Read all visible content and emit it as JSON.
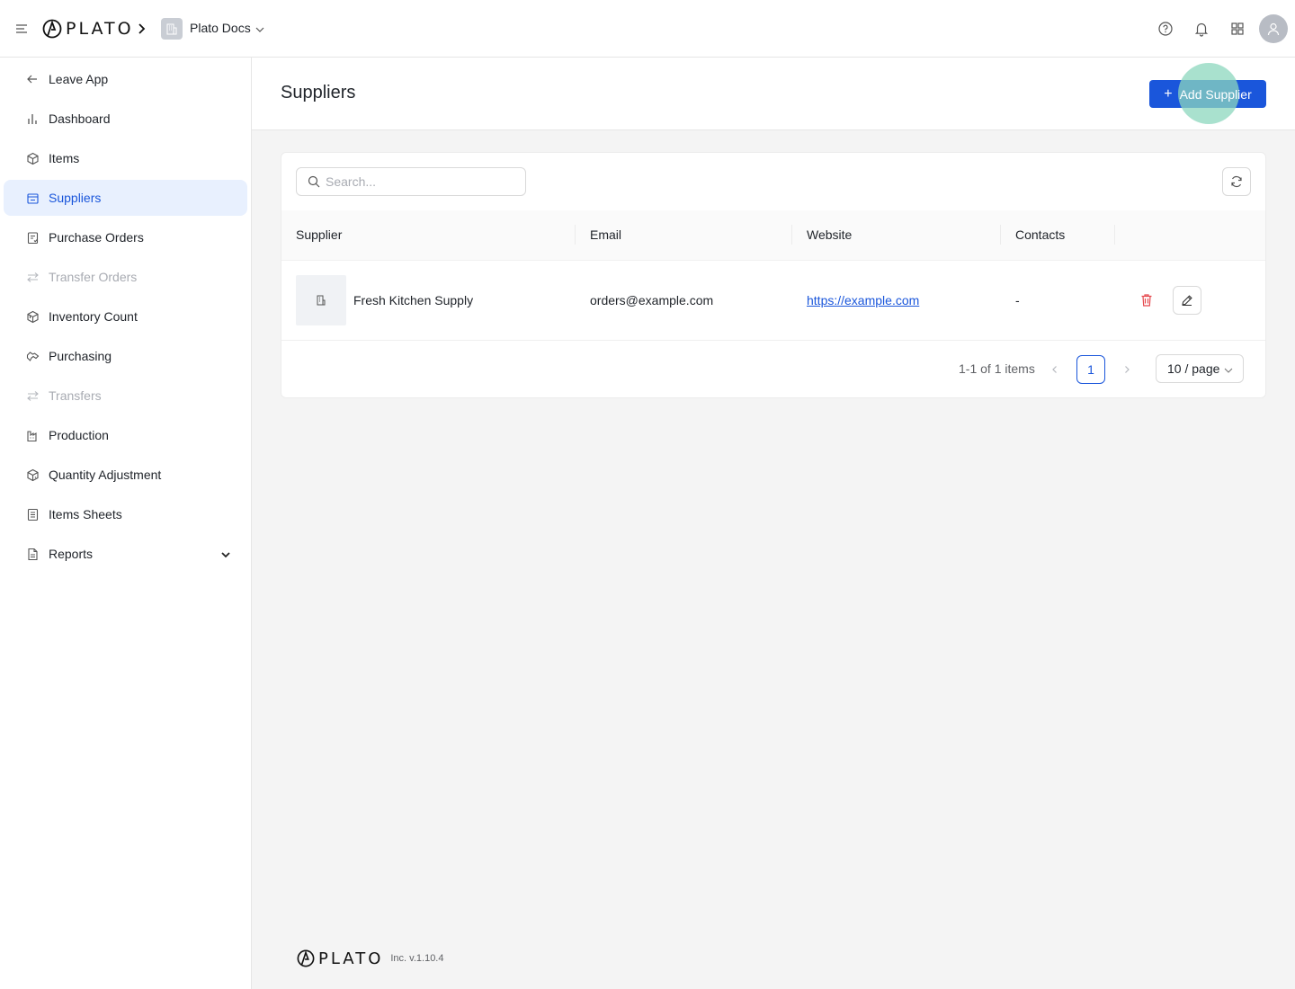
{
  "topbar": {
    "brand": "PLATO",
    "org_name": "Plato Docs"
  },
  "sidebar": {
    "items": [
      {
        "label": "Leave App",
        "icon": "arrow-left-icon",
        "state": "normal"
      },
      {
        "label": "Dashboard",
        "icon": "bar-chart-icon",
        "state": "normal"
      },
      {
        "label": "Items",
        "icon": "box-icon",
        "state": "normal"
      },
      {
        "label": "Suppliers",
        "icon": "store-icon",
        "state": "active"
      },
      {
        "label": "Purchase Orders",
        "icon": "clipboard-icon",
        "state": "normal"
      },
      {
        "label": "Transfer Orders",
        "icon": "transfer-icon",
        "state": "disabled"
      },
      {
        "label": "Inventory Count",
        "icon": "boxes-icon",
        "state": "normal"
      },
      {
        "label": "Purchasing",
        "icon": "handshake-icon",
        "state": "normal"
      },
      {
        "label": "Transfers",
        "icon": "transfer-icon",
        "state": "disabled"
      },
      {
        "label": "Production",
        "icon": "factory-icon",
        "state": "normal"
      },
      {
        "label": "Quantity Adjustment",
        "icon": "box-adjust-icon",
        "state": "normal"
      },
      {
        "label": "Items Sheets",
        "icon": "sheet-icon",
        "state": "normal"
      },
      {
        "label": "Reports",
        "icon": "report-icon",
        "state": "normal"
      }
    ]
  },
  "page": {
    "title": "Suppliers",
    "add_button_label": "Add Supplier"
  },
  "table": {
    "search_placeholder": "Search...",
    "columns": [
      "Supplier",
      "Email",
      "Website",
      "Contacts"
    ],
    "rows": [
      {
        "supplier": "Fresh Kitchen Supply",
        "email": "orders@example.com",
        "website": "https://example.com",
        "contacts": "-"
      }
    ]
  },
  "pagination": {
    "total_text": "1-1 of 1 items",
    "current_page": "1",
    "page_size": "10 / page"
  },
  "footer": {
    "brand": "PLATO",
    "version": "Inc. v.1.10.4"
  },
  "colors": {
    "accent": "#1a56db",
    "active_bg": "#e8f0fe",
    "danger": "#e5484d"
  }
}
